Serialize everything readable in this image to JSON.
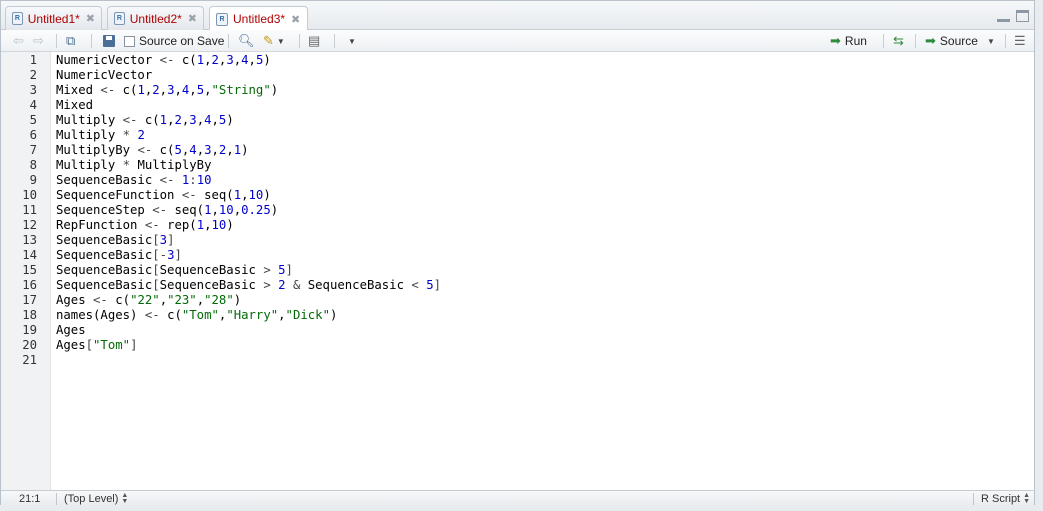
{
  "tabs": [
    {
      "label": "Untitled1*",
      "active": false
    },
    {
      "label": "Untitled2*",
      "active": false
    },
    {
      "label": "Untitled3*",
      "active": true
    }
  ],
  "toolbar": {
    "source_on_save_label": "Source on Save",
    "run_label": "Run",
    "source_label": "Source"
  },
  "editor": {
    "line_numbers": [
      "1",
      "2",
      "3",
      "4",
      "5",
      "6",
      "7",
      "8",
      "9",
      "10",
      "11",
      "12",
      "13",
      "14",
      "15",
      "16",
      "17",
      "18",
      "19",
      "20",
      "21"
    ],
    "lines": [
      [
        {
          "t": "NumericVector ",
          "c": ""
        },
        {
          "t": "<- ",
          "c": "op"
        },
        {
          "t": "c(",
          "c": ""
        },
        {
          "t": "1",
          "c": "num"
        },
        {
          "t": ",",
          "c": ""
        },
        {
          "t": "2",
          "c": "num"
        },
        {
          "t": ",",
          "c": ""
        },
        {
          "t": "3",
          "c": "num"
        },
        {
          "t": ",",
          "c": ""
        },
        {
          "t": "4",
          "c": "num"
        },
        {
          "t": ",",
          "c": ""
        },
        {
          "t": "5",
          "c": "num"
        },
        {
          "t": ")",
          "c": ""
        }
      ],
      [
        {
          "t": "NumericVector",
          "c": ""
        }
      ],
      [
        {
          "t": "Mixed ",
          "c": ""
        },
        {
          "t": "<- ",
          "c": "op"
        },
        {
          "t": "c(",
          "c": ""
        },
        {
          "t": "1",
          "c": "num"
        },
        {
          "t": ",",
          "c": ""
        },
        {
          "t": "2",
          "c": "num"
        },
        {
          "t": ",",
          "c": ""
        },
        {
          "t": "3",
          "c": "num"
        },
        {
          "t": ",",
          "c": ""
        },
        {
          "t": "4",
          "c": "num"
        },
        {
          "t": ",",
          "c": ""
        },
        {
          "t": "5",
          "c": "num"
        },
        {
          "t": ",",
          "c": ""
        },
        {
          "t": "\"String\"",
          "c": "str"
        },
        {
          "t": ")",
          "c": ""
        }
      ],
      [
        {
          "t": "Mixed",
          "c": ""
        }
      ],
      [
        {
          "t": "Multiply ",
          "c": ""
        },
        {
          "t": "<- ",
          "c": "op"
        },
        {
          "t": "c(",
          "c": ""
        },
        {
          "t": "1",
          "c": "num"
        },
        {
          "t": ",",
          "c": ""
        },
        {
          "t": "2",
          "c": "num"
        },
        {
          "t": ",",
          "c": ""
        },
        {
          "t": "3",
          "c": "num"
        },
        {
          "t": ",",
          "c": ""
        },
        {
          "t": "4",
          "c": "num"
        },
        {
          "t": ",",
          "c": ""
        },
        {
          "t": "5",
          "c": "num"
        },
        {
          "t": ")",
          "c": ""
        }
      ],
      [
        {
          "t": "Multiply ",
          "c": ""
        },
        {
          "t": "* ",
          "c": "op"
        },
        {
          "t": "2",
          "c": "num"
        }
      ],
      [
        {
          "t": "MultiplyBy ",
          "c": ""
        },
        {
          "t": "<- ",
          "c": "op"
        },
        {
          "t": "c(",
          "c": ""
        },
        {
          "t": "5",
          "c": "num"
        },
        {
          "t": ",",
          "c": ""
        },
        {
          "t": "4",
          "c": "num"
        },
        {
          "t": ",",
          "c": ""
        },
        {
          "t": "3",
          "c": "num"
        },
        {
          "t": ",",
          "c": ""
        },
        {
          "t": "2",
          "c": "num"
        },
        {
          "t": ",",
          "c": ""
        },
        {
          "t": "1",
          "c": "num"
        },
        {
          "t": ")",
          "c": ""
        }
      ],
      [
        {
          "t": "Multiply ",
          "c": ""
        },
        {
          "t": "* ",
          "c": "op"
        },
        {
          "t": "MultiplyBy",
          "c": ""
        }
      ],
      [
        {
          "t": "SequenceBasic ",
          "c": ""
        },
        {
          "t": "<- ",
          "c": "op"
        },
        {
          "t": "1",
          "c": "num"
        },
        {
          "t": ":",
          "c": "op"
        },
        {
          "t": "10",
          "c": "num"
        }
      ],
      [
        {
          "t": "SequenceFunction ",
          "c": ""
        },
        {
          "t": "<- ",
          "c": "op"
        },
        {
          "t": "seq(",
          "c": ""
        },
        {
          "t": "1",
          "c": "num"
        },
        {
          "t": ",",
          "c": ""
        },
        {
          "t": "10",
          "c": "num"
        },
        {
          "t": ")",
          "c": ""
        }
      ],
      [
        {
          "t": "SequenceStep ",
          "c": ""
        },
        {
          "t": "<- ",
          "c": "op"
        },
        {
          "t": "seq(",
          "c": ""
        },
        {
          "t": "1",
          "c": "num"
        },
        {
          "t": ",",
          "c": ""
        },
        {
          "t": "10",
          "c": "num"
        },
        {
          "t": ",",
          "c": ""
        },
        {
          "t": "0.25",
          "c": "num"
        },
        {
          "t": ")",
          "c": ""
        }
      ],
      [
        {
          "t": "RepFunction ",
          "c": ""
        },
        {
          "t": "<- ",
          "c": "op"
        },
        {
          "t": "rep(",
          "c": ""
        },
        {
          "t": "1",
          "c": "num"
        },
        {
          "t": ",",
          "c": ""
        },
        {
          "t": "10",
          "c": "num"
        },
        {
          "t": ")",
          "c": ""
        }
      ],
      [
        {
          "t": "SequenceBasic",
          "c": ""
        },
        {
          "t": "[",
          "c": "op"
        },
        {
          "t": "3",
          "c": "num"
        },
        {
          "t": "]",
          "c": "op"
        }
      ],
      [
        {
          "t": "SequenceBasic",
          "c": ""
        },
        {
          "t": "[-",
          "c": "op"
        },
        {
          "t": "3",
          "c": "num"
        },
        {
          "t": "]",
          "c": "op"
        }
      ],
      [
        {
          "t": "SequenceBasic",
          "c": ""
        },
        {
          "t": "[",
          "c": "op"
        },
        {
          "t": "SequenceBasic ",
          "c": ""
        },
        {
          "t": "> ",
          "c": "op"
        },
        {
          "t": "5",
          "c": "num"
        },
        {
          "t": "]",
          "c": "op"
        }
      ],
      [
        {
          "t": "SequenceBasic",
          "c": ""
        },
        {
          "t": "[",
          "c": "op"
        },
        {
          "t": "SequenceBasic ",
          "c": ""
        },
        {
          "t": "> ",
          "c": "op"
        },
        {
          "t": "2 ",
          "c": "num"
        },
        {
          "t": "& ",
          "c": "op"
        },
        {
          "t": "SequenceBasic ",
          "c": ""
        },
        {
          "t": "< ",
          "c": "op"
        },
        {
          "t": "5",
          "c": "num"
        },
        {
          "t": "]",
          "c": "op"
        }
      ],
      [
        {
          "t": "Ages ",
          "c": ""
        },
        {
          "t": "<- ",
          "c": "op"
        },
        {
          "t": "c(",
          "c": ""
        },
        {
          "t": "\"22\"",
          "c": "str"
        },
        {
          "t": ",",
          "c": ""
        },
        {
          "t": "\"23\"",
          "c": "str"
        },
        {
          "t": ",",
          "c": ""
        },
        {
          "t": "\"28\"",
          "c": "str"
        },
        {
          "t": ")",
          "c": ""
        }
      ],
      [
        {
          "t": "names(Ages) ",
          "c": ""
        },
        {
          "t": "<- ",
          "c": "op"
        },
        {
          "t": "c(",
          "c": ""
        },
        {
          "t": "\"Tom\"",
          "c": "str"
        },
        {
          "t": ",",
          "c": ""
        },
        {
          "t": "\"Harry\"",
          "c": "str"
        },
        {
          "t": ",",
          "c": ""
        },
        {
          "t": "\"Dick\"",
          "c": "str"
        },
        {
          "t": ")",
          "c": ""
        }
      ],
      [
        {
          "t": "Ages",
          "c": ""
        }
      ],
      [
        {
          "t": "Ages",
          "c": ""
        },
        {
          "t": "[",
          "c": "op"
        },
        {
          "t": "\"Tom\"",
          "c": "str"
        },
        {
          "t": "]",
          "c": "op"
        }
      ],
      []
    ]
  },
  "status": {
    "cursor_position": "21:1",
    "scope": "(Top Level)",
    "file_type": "R Script"
  },
  "colors": {
    "tab_text": "#b00000",
    "number": "#0000cc",
    "string": "#036a07"
  }
}
